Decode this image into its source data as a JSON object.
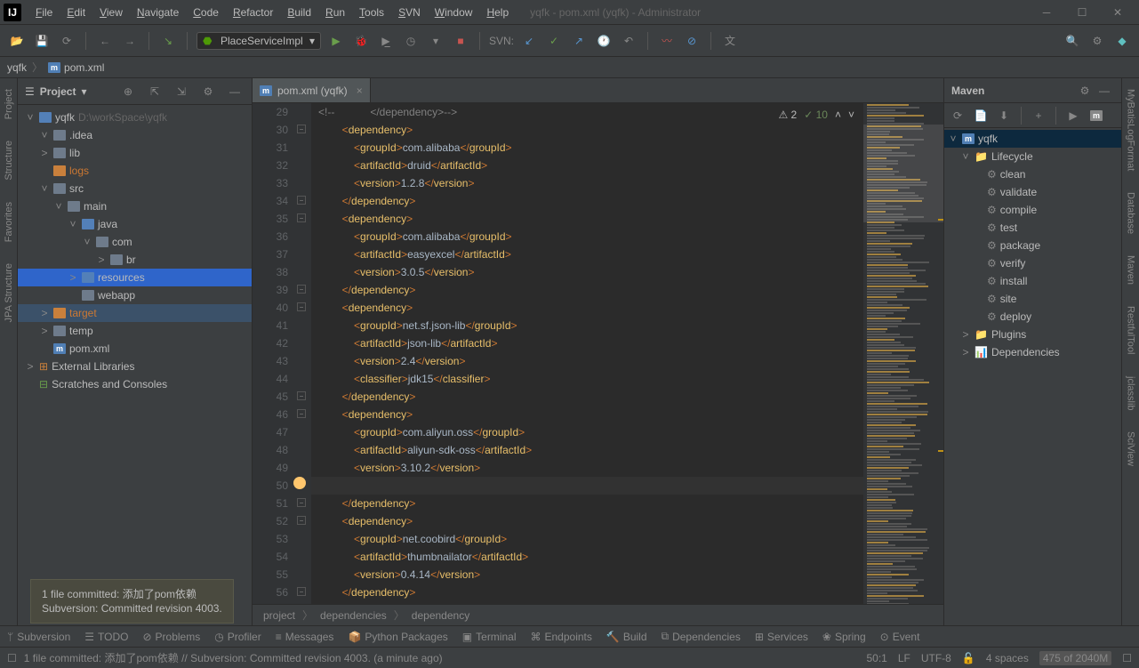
{
  "window": {
    "title": "yqfk - pom.xml (yqfk) - Administrator"
  },
  "menus": [
    "File",
    "Edit",
    "View",
    "Navigate",
    "Code",
    "Refactor",
    "Build",
    "Run",
    "Tools",
    "SVN",
    "Window",
    "Help"
  ],
  "toolbar": {
    "run_config": "PlaceServiceImpl",
    "svn_label": "SVN:"
  },
  "breadcrumb": {
    "project": "yqfk",
    "file": "pom.xml"
  },
  "project_panel": {
    "title": "Project",
    "tree": [
      {
        "depth": 0,
        "exp": true,
        "icon": "folder-blue",
        "label": "yqfk",
        "path": "D:\\workSpace\\yqfk"
      },
      {
        "depth": 1,
        "exp": true,
        "icon": "folder-c",
        "label": ".idea"
      },
      {
        "depth": 1,
        "exp": false,
        "icon": "folder-c",
        "label": "lib",
        "chev": ">"
      },
      {
        "depth": 1,
        "exp": false,
        "icon": "folder-orange",
        "label": "logs",
        "labelClass": "orange"
      },
      {
        "depth": 1,
        "exp": true,
        "icon": "folder-c",
        "label": "src"
      },
      {
        "depth": 2,
        "exp": true,
        "icon": "folder-c",
        "label": "main"
      },
      {
        "depth": 3,
        "exp": true,
        "icon": "folder-blue",
        "label": "java"
      },
      {
        "depth": 4,
        "exp": true,
        "icon": "folder-c",
        "label": "com"
      },
      {
        "depth": 5,
        "exp": false,
        "icon": "folder-c",
        "label": "br",
        "chev": ">"
      },
      {
        "depth": 3,
        "exp": false,
        "icon": "folder-blue",
        "label": "resources",
        "chev": ">",
        "selected": true
      },
      {
        "depth": 3,
        "exp": false,
        "icon": "folder-c",
        "label": "webapp"
      },
      {
        "depth": 1,
        "exp": false,
        "icon": "folder-orange",
        "label": "target",
        "chev": ">",
        "labelClass": "orange",
        "highlighted": true
      },
      {
        "depth": 1,
        "exp": false,
        "icon": "folder-c",
        "label": "temp",
        "chev": ">"
      },
      {
        "depth": 1,
        "exp": false,
        "icon": "m",
        "label": "pom.xml"
      },
      {
        "depth": 0,
        "exp": false,
        "icon": "lib",
        "label": "External Libraries",
        "chev": ">"
      },
      {
        "depth": 0,
        "exp": false,
        "icon": "scratch",
        "label": "Scratches and Consoles"
      }
    ]
  },
  "editor": {
    "tab_label": "pom.xml (yqfk)",
    "inspections": {
      "warnings": "2",
      "ok": "10"
    },
    "lines": [
      {
        "n": 29,
        "html": "<span class='comment'>&lt;!--            &lt;/dependency&gt;--&gt;</span>"
      },
      {
        "n": 30,
        "html": "        <span class='tag'>&lt;</span><span class='tagname'>dependency</span><span class='tag'>&gt;</span>"
      },
      {
        "n": 31,
        "html": "            <span class='tag'>&lt;</span><span class='tagname'>groupId</span><span class='tag'>&gt;</span><span class='text'>com.alibaba</span><span class='tag'>&lt;/</span><span class='tagname'>groupId</span><span class='tag'>&gt;</span>"
      },
      {
        "n": 32,
        "html": "            <span class='tag'>&lt;</span><span class='tagname'>artifactId</span><span class='tag'>&gt;</span><span class='text'>druid</span><span class='tag'>&lt;/</span><span class='tagname'>artifactId</span><span class='tag'>&gt;</span>"
      },
      {
        "n": 33,
        "html": "            <span class='tag'>&lt;</span><span class='tagname'>version</span><span class='tag'>&gt;</span><span class='text'>1.2.8</span><span class='tag'>&lt;/</span><span class='tagname'>version</span><span class='tag'>&gt;</span>"
      },
      {
        "n": 34,
        "html": "        <span class='tag'>&lt;/</span><span class='tagname'>dependency</span><span class='tag'>&gt;</span>"
      },
      {
        "n": 35,
        "html": "        <span class='tag'>&lt;</span><span class='tagname'>dependency</span><span class='tag'>&gt;</span>"
      },
      {
        "n": 36,
        "html": "            <span class='tag'>&lt;</span><span class='tagname'>groupId</span><span class='tag'>&gt;</span><span class='text'>com.alibaba</span><span class='tag'>&lt;/</span><span class='tagname'>groupId</span><span class='tag'>&gt;</span>"
      },
      {
        "n": 37,
        "html": "            <span class='tag'>&lt;</span><span class='tagname'>artifactId</span><span class='tag'>&gt;</span><span class='text'>easyexcel</span><span class='tag'>&lt;/</span><span class='tagname'>artifactId</span><span class='tag'>&gt;</span>"
      },
      {
        "n": 38,
        "html": "            <span class='tag'>&lt;</span><span class='tagname'>version</span><span class='tag'>&gt;</span><span class='text'>3.0.5</span><span class='tag'>&lt;/</span><span class='tagname'>version</span><span class='tag'>&gt;</span>"
      },
      {
        "n": 39,
        "html": "        <span class='tag'>&lt;/</span><span class='tagname'>dependency</span><span class='tag'>&gt;</span>"
      },
      {
        "n": 40,
        "html": "        <span class='tag'>&lt;</span><span class='tagname'>dependency</span><span class='tag'>&gt;</span>"
      },
      {
        "n": 41,
        "html": "            <span class='tag'>&lt;</span><span class='tagname'>groupId</span><span class='tag'>&gt;</span><span class='text'>net.sf.json-lib</span><span class='tag'>&lt;/</span><span class='tagname'>groupId</span><span class='tag'>&gt;</span>"
      },
      {
        "n": 42,
        "html": "            <span class='tag'>&lt;</span><span class='tagname'>artifactId</span><span class='tag'>&gt;</span><span class='text'>json-lib</span><span class='tag'>&lt;/</span><span class='tagname'>artifactId</span><span class='tag'>&gt;</span>"
      },
      {
        "n": 43,
        "html": "            <span class='tag'>&lt;</span><span class='tagname'>version</span><span class='tag'>&gt;</span><span class='text'>2.4</span><span class='tag'>&lt;/</span><span class='tagname'>version</span><span class='tag'>&gt;</span>"
      },
      {
        "n": 44,
        "html": "            <span class='tag'>&lt;</span><span class='tagname'>classifier</span><span class='tag'>&gt;</span><span class='text'>jdk15</span><span class='tag'>&lt;/</span><span class='tagname'>classifier</span><span class='tag'>&gt;</span>"
      },
      {
        "n": 45,
        "html": "        <span class='tag'>&lt;/</span><span class='tagname'>dependency</span><span class='tag'>&gt;</span>"
      },
      {
        "n": 46,
        "html": "        <span class='tag'>&lt;</span><span class='tagname'>dependency</span><span class='tag'>&gt;</span>"
      },
      {
        "n": 47,
        "html": "            <span class='tag'>&lt;</span><span class='tagname'>groupId</span><span class='tag'>&gt;</span><span class='text'>com.aliyun.oss</span><span class='tag'>&lt;/</span><span class='tagname'>groupId</span><span class='tag'>&gt;</span>"
      },
      {
        "n": 48,
        "html": "            <span class='tag'>&lt;</span><span class='tagname'>artifactId</span><span class='tag'>&gt;</span><span class='text'>aliyun-sdk-oss</span><span class='tag'>&lt;/</span><span class='tagname'>artifactId</span><span class='tag'>&gt;</span>"
      },
      {
        "n": 49,
        "html": "            <span class='tag'>&lt;</span><span class='tagname'>version</span><span class='tag'>&gt;</span><span class='text'>3.10.2</span><span class='tag'>&lt;/</span><span class='tagname'>version</span><span class='tag'>&gt;</span>",
        "bulb": true
      },
      {
        "n": 50,
        "html": "",
        "caret": true
      },
      {
        "n": 51,
        "html": "        <span class='tag'>&lt;/</span><span class='tagname'>dependency</span><span class='tag'>&gt;</span>"
      },
      {
        "n": 52,
        "html": "        <span class='tag'>&lt;</span><span class='tagname'>dependency</span><span class='tag'>&gt;</span>"
      },
      {
        "n": 53,
        "html": "            <span class='tag'>&lt;</span><span class='tagname'>groupId</span><span class='tag'>&gt;</span><span class='text'>net.coobird</span><span class='tag'>&lt;/</span><span class='tagname'>groupId</span><span class='tag'>&gt;</span>"
      },
      {
        "n": 54,
        "html": "            <span class='tag'>&lt;</span><span class='tagname'>artifactId</span><span class='tag'>&gt;</span><span class='text'>thumbnailator</span><span class='tag'>&lt;/</span><span class='tagname'>artifactId</span><span class='tag'>&gt;</span>"
      },
      {
        "n": 55,
        "html": "            <span class='tag'>&lt;</span><span class='tagname'>version</span><span class='tag'>&gt;</span><span class='text'>0.4.14</span><span class='tag'>&lt;/</span><span class='tagname'>version</span><span class='tag'>&gt;</span>"
      },
      {
        "n": 56,
        "html": "        <span class='tag'>&lt;/</span><span class='tagname'>dependency</span><span class='tag'>&gt;</span>"
      }
    ],
    "breadcrumb": [
      "project",
      "dependencies",
      "dependency"
    ]
  },
  "maven": {
    "title": "Maven",
    "root": "yqfk",
    "lifecycle_label": "Lifecycle",
    "goals": [
      "clean",
      "validate",
      "compile",
      "test",
      "package",
      "verify",
      "install",
      "site",
      "deploy"
    ],
    "plugins_label": "Plugins",
    "deps_label": "Dependencies"
  },
  "left_rail": [
    "Project",
    "Structure",
    "Favorites",
    "JPA Structure"
  ],
  "right_rail": [
    "MyBatisLogFormat",
    "Database",
    "Maven",
    "RestfulTool",
    "jclasslib",
    "SciView"
  ],
  "toolwindows": [
    "Subversion",
    "TODO",
    "Problems",
    "Profiler",
    "Messages",
    "Python Packages",
    "Terminal",
    "Endpoints",
    "Build",
    "Dependencies",
    "Services",
    "Spring",
    "Event"
  ],
  "notification": {
    "l1": "1 file committed: 添加了pom依赖",
    "l2": "Subversion: Committed revision 4003."
  },
  "statusbar": {
    "msg": "1 file committed: 添加了pom依赖 // Subversion: Committed revision 4003. (a minute ago)",
    "pos": "50:1",
    "lf": "LF",
    "enc": "UTF-8",
    "indent": "4 spaces",
    "mem": "475 of 2040M"
  }
}
